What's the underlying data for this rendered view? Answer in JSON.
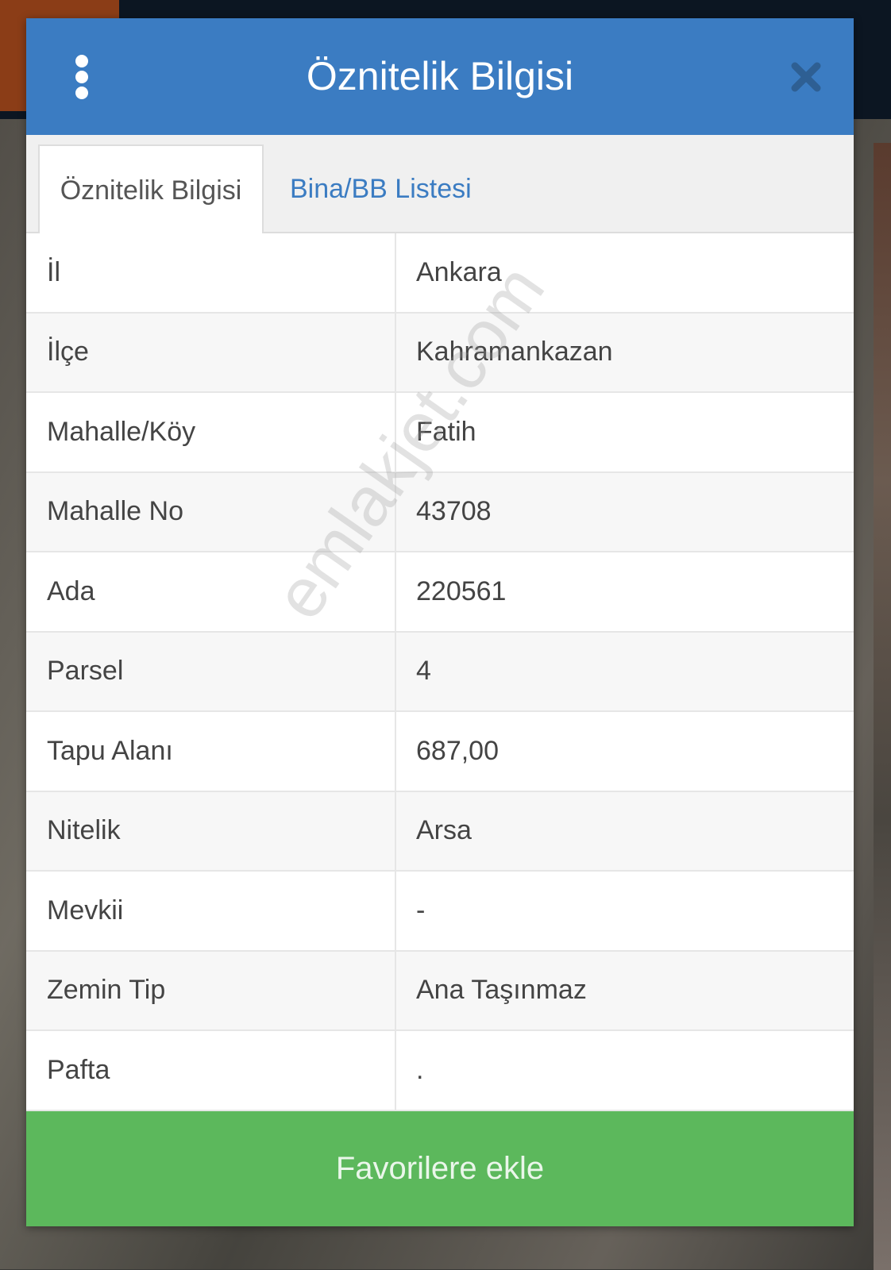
{
  "dialog": {
    "title": "Öznitelik Bilgisi",
    "menu_icon": "vertical-dots-icon",
    "close_icon": "close-x-icon"
  },
  "tabs": [
    {
      "label": "Öznitelik Bilgisi",
      "active": true
    },
    {
      "label": "Bina/BB Listesi",
      "active": false
    }
  ],
  "attributes": [
    {
      "key": "İl",
      "value": "Ankara"
    },
    {
      "key": "İlçe",
      "value": "Kahramankazan"
    },
    {
      "key": "Mahalle/Köy",
      "value": "Fatih"
    },
    {
      "key": "Mahalle No",
      "value": "43708"
    },
    {
      "key": "Ada",
      "value": "220561"
    },
    {
      "key": "Parsel",
      "value": "4"
    },
    {
      "key": "Tapu Alanı",
      "value": "687,00"
    },
    {
      "key": "Nitelik",
      "value": "Arsa"
    },
    {
      "key": "Mevkii",
      "value": "-"
    },
    {
      "key": "Zemin Tip",
      "value": "Ana Taşınmaz"
    },
    {
      "key": "Pafta",
      "value": "."
    }
  ],
  "footer": {
    "favorite_label": "Favorilere ekle"
  },
  "watermark": "emlakjet.com",
  "colors": {
    "header": "#3b7cc2",
    "tab_link": "#3b7cc2",
    "favorite_button": "#5cb85c"
  }
}
